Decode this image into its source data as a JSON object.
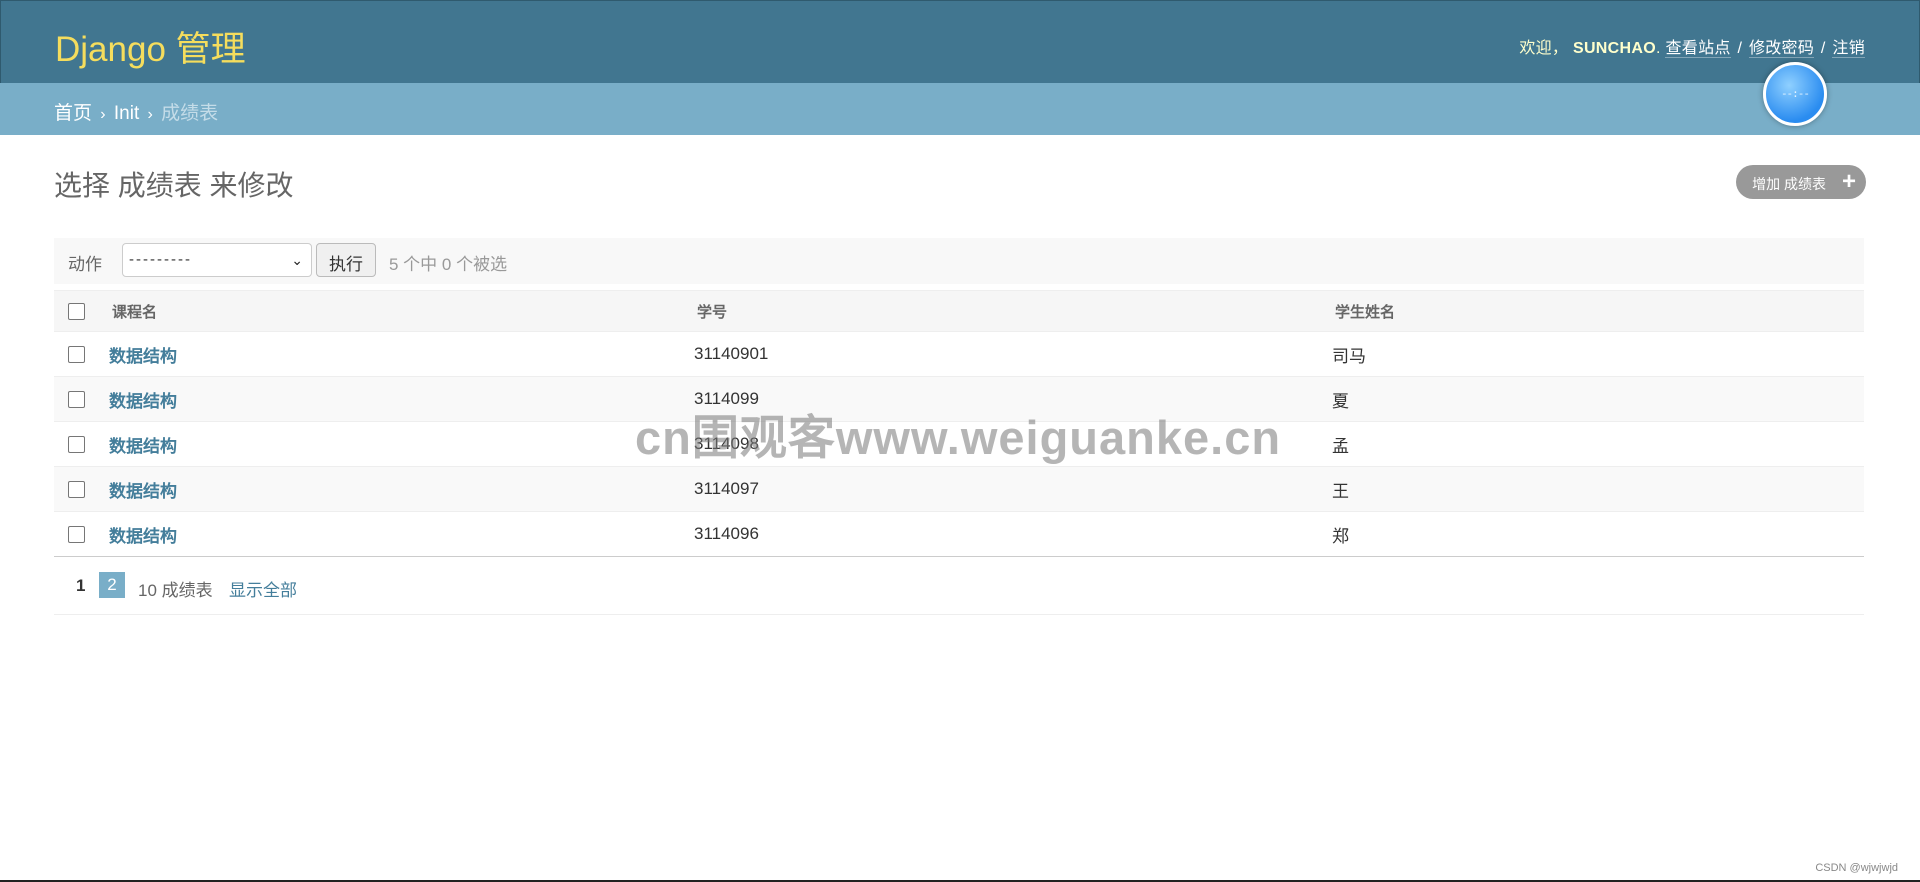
{
  "header": {
    "brand": "Django 管理",
    "user_tools": {
      "welcome": "欢迎，",
      "username": "SUNCHAO",
      "view_site": "查看站点",
      "change_password": "修改密码",
      "logout": "注销"
    }
  },
  "breadcrumbs": {
    "home": "首页",
    "app": "Init",
    "current": "成绩表"
  },
  "clock_widget": {
    "text": "--:--"
  },
  "page": {
    "title": "选择 成绩表 来修改",
    "add_button": "增加 成绩表"
  },
  "actions": {
    "label": "动作",
    "select_value": "---------",
    "go_button": "执行",
    "selection_count": "5 个中 0 个被选"
  },
  "table": {
    "columns": [
      "课程名",
      "学号",
      "学生姓名"
    ],
    "rows": [
      {
        "course": "数据结构",
        "student_id": "31140901",
        "name": "司马"
      },
      {
        "course": "数据结构",
        "student_id": "3114099",
        "name": "夏"
      },
      {
        "course": "数据结构",
        "student_id": "3114098",
        "name": "孟"
      },
      {
        "course": "数据结构",
        "student_id": "3114097",
        "name": "王"
      },
      {
        "course": "数据结构",
        "student_id": "3114096",
        "name": "郑"
      }
    ]
  },
  "paginator": {
    "current_page": "1",
    "next_page": "2",
    "count": "10 成绩表",
    "show_all": "显示全部"
  },
  "overlay": {
    "watermark": "cn围观客www.weiguanke.cn",
    "credit": "CSDN @wjwjwjd"
  },
  "colors": {
    "header_bg": "#417690",
    "brand": "#f5dd5d",
    "breadcrumbs_bg": "#79aec8",
    "link": "#447e9b",
    "add_button_bg": "#999999"
  }
}
